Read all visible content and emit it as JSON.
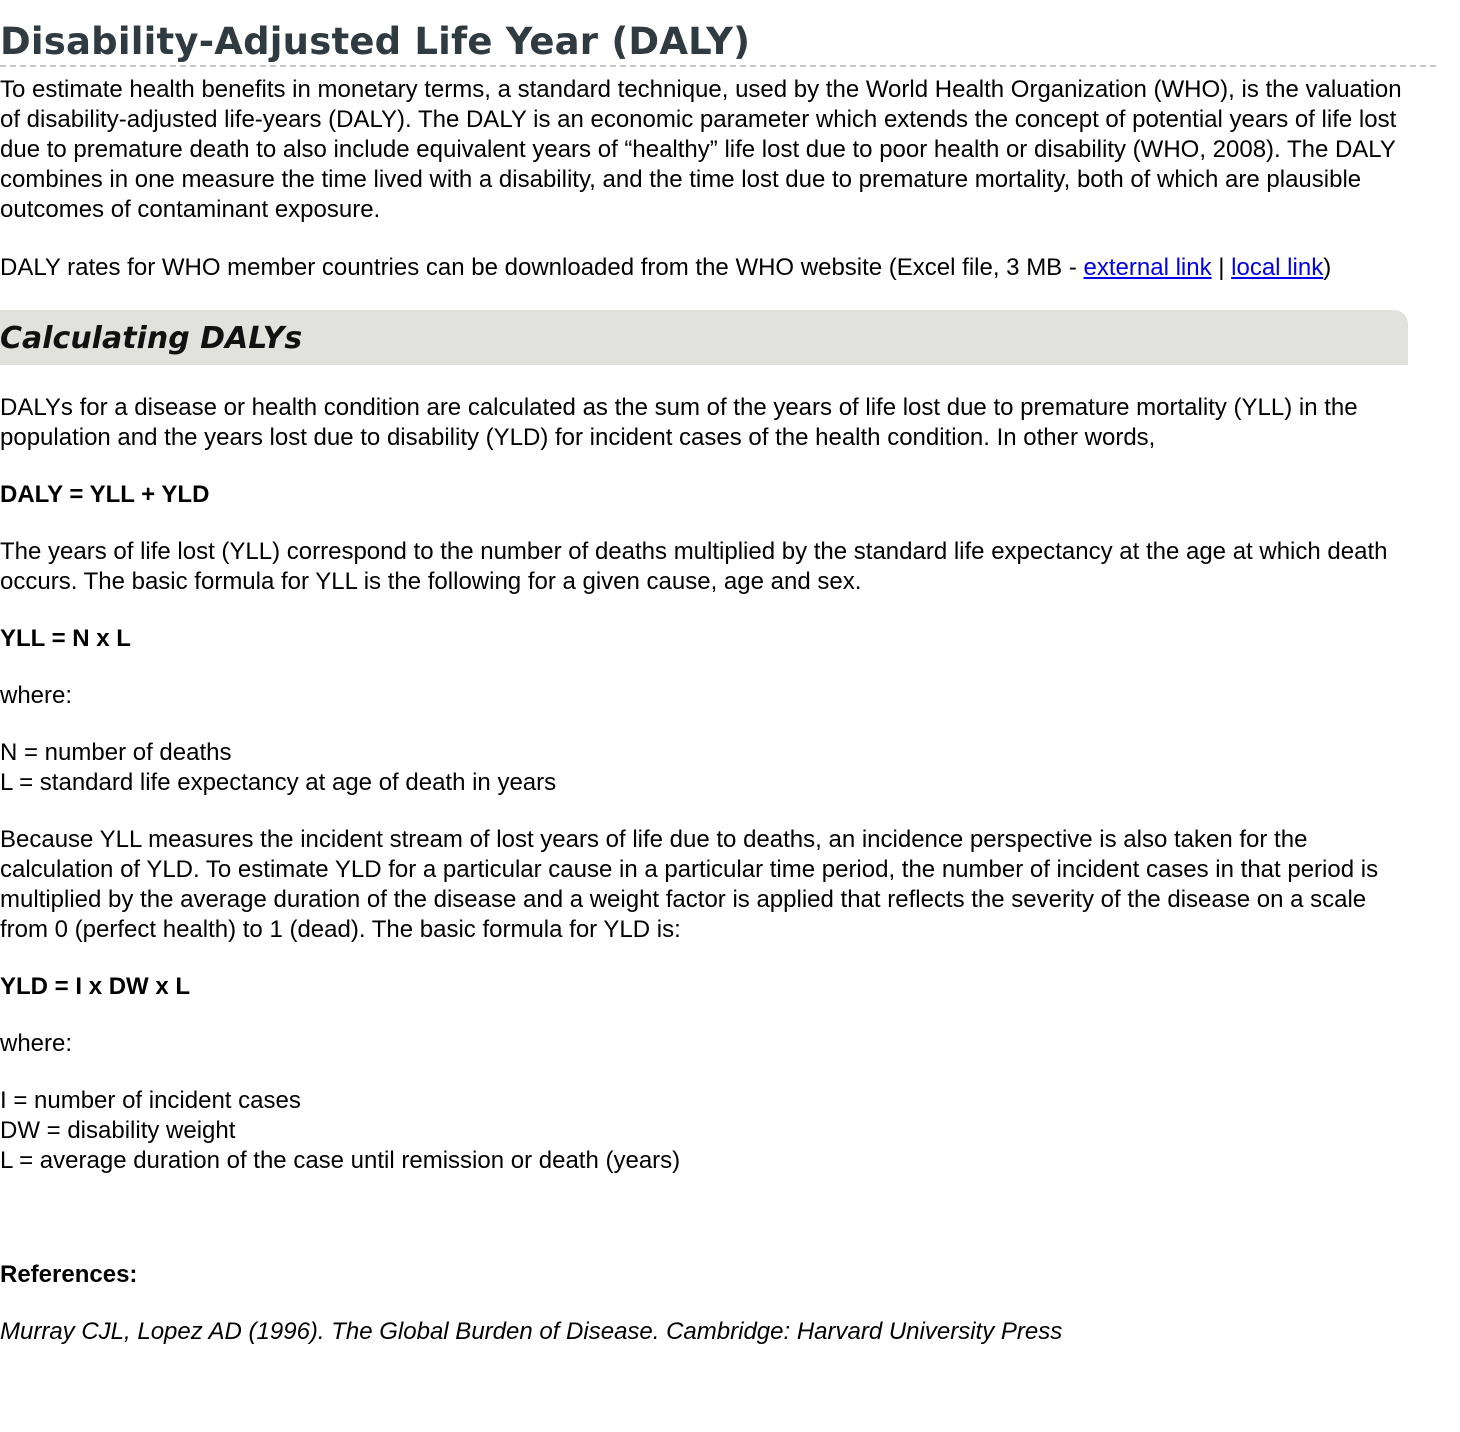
{
  "title": "Disability-Adjusted Life Year (DALY)",
  "intro": "To estimate health benefits in monetary terms, a standard technique, used by the World Health Organization (WHO), is the valuation of disability-adjusted life-years (DALY). The DALY is an economic parameter which extends the concept of potential years of life lost due to premature death to also include equivalent years of “healthy” life lost due to poor health or disability (WHO, 2008). The DALY combines in one measure the time lived with a disability, and the time lost due to premature mortality, both of which are plausible outcomes of contaminant exposure.",
  "download": {
    "prefix": "DALY rates for WHO member countries can be downloaded from the WHO website (Excel file, 3 MB - ",
    "external_link_label": "external link",
    "separator": " | ",
    "local_link_label": "local link",
    "suffix": ")"
  },
  "section": {
    "title": "Calculating DALYs",
    "daly_definition": "DALYs for a disease or health condition are calculated as the sum of the years of life lost due to premature mortality (YLL) in the population and the years lost due to disability (YLD) for incident cases of the health condition. In other words,",
    "daly_formula": "DALY = YLL + YLD",
    "yll_definition": "The years of life lost (YLL) correspond to the number of deaths multiplied by the standard life expectancy at the age at which death occurs. The basic formula for YLL is the following for a given cause, age and sex.",
    "yll_formula": "YLL = N x L",
    "yll_where": "where:",
    "yll_terms": [
      "N = number of deaths",
      "L = standard life expectancy at age of death in years"
    ],
    "yld_definition": "Because YLL measures the incident stream of lost years of life due to deaths, an incidence perspective is also taken for the calculation of YLD. To estimate YLD for a particular cause in a particular time period, the number of incident cases in that period is multiplied by the average duration of the disease and a weight factor is applied that reflects the severity of the disease on a scale from 0 (perfect health) to 1 (dead). The basic formula for YLD is:",
    "yld_formula": "YLD = I x DW x L",
    "yld_where": "where:",
    "yld_terms": [
      "I = number of incident cases",
      "DW = disability weight",
      "L = average duration of the case until remission or death (years)"
    ]
  },
  "references": {
    "heading": "References:",
    "items": [
      "Murray CJL, Lopez AD (1996). The Global Burden of Disease. Cambridge: Harvard University Press"
    ]
  },
  "colors": {
    "title": "#2f3a41",
    "section_band": "#e1e2dd",
    "link": "#0000ee"
  }
}
